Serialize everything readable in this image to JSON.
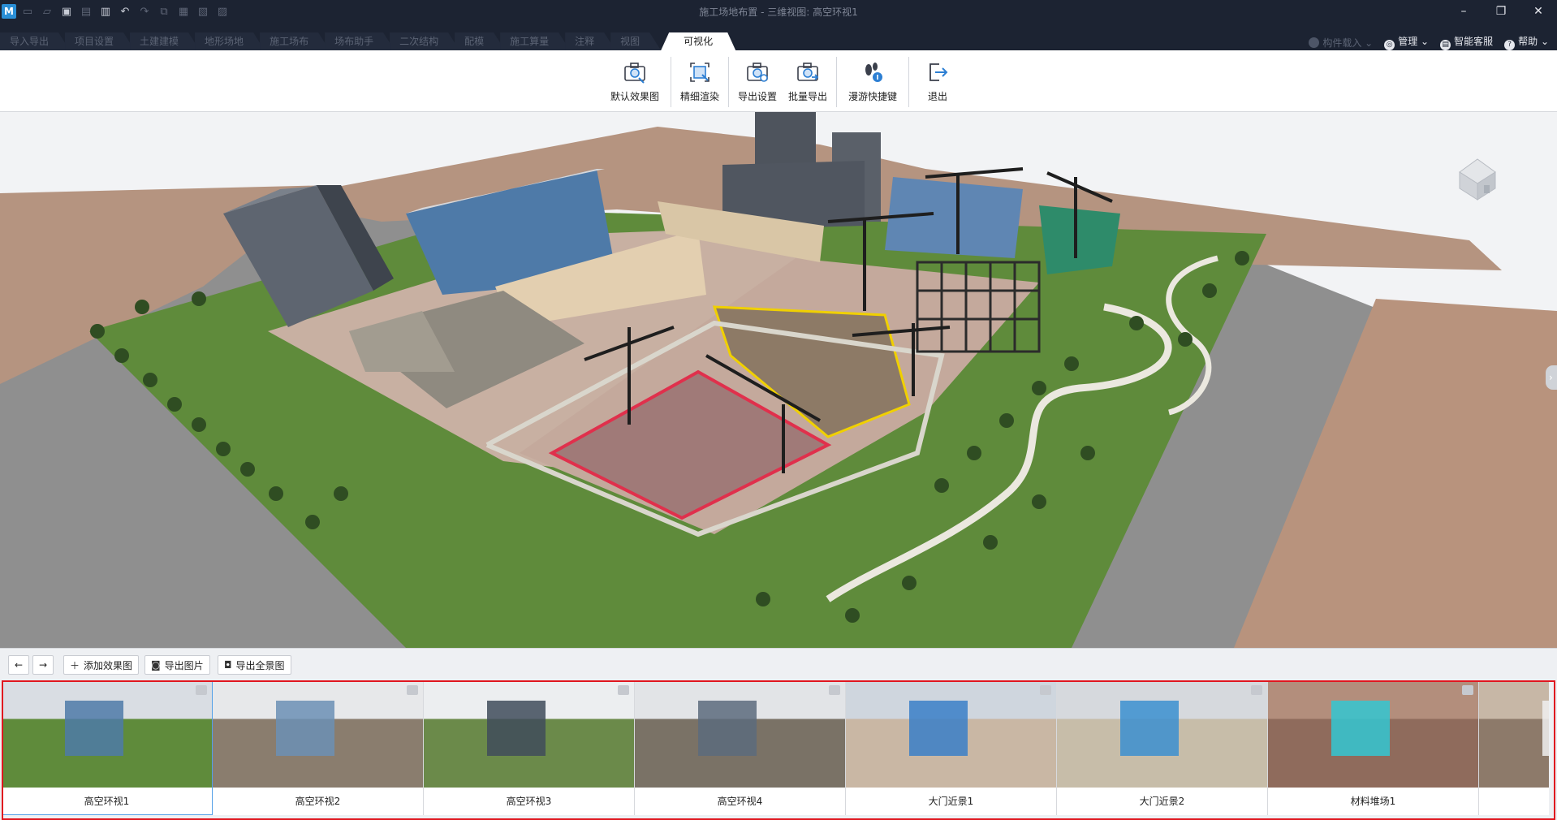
{
  "window": {
    "title": "施工场地布置 - 三维视图: 高空环视1",
    "logo": "M",
    "controls": {
      "minimize": "–",
      "restore": "❐",
      "close": "✕"
    }
  },
  "quick_access": [
    "file-icon",
    "open-icon",
    "save-icon",
    "save-as-icon",
    "export-icon",
    "undo-icon",
    "redo-icon",
    "copy-icon",
    "paste-icon",
    "window-icon",
    "layout-icon"
  ],
  "menu_tabs": [
    {
      "label": "导入导出"
    },
    {
      "label": "项目设置"
    },
    {
      "label": "土建建模"
    },
    {
      "label": "地形场地"
    },
    {
      "label": "施工场布"
    },
    {
      "label": "场布助手"
    },
    {
      "label": "二次结构"
    },
    {
      "label": "配模"
    },
    {
      "label": "施工算量"
    },
    {
      "label": "注释"
    },
    {
      "label": "视图"
    },
    {
      "label": "可视化",
      "active": true
    }
  ],
  "right_menu": {
    "component_load": "构件载入",
    "manage": "管理",
    "support": "智能客服",
    "help": "帮助"
  },
  "ribbon": {
    "default_render": "默认效果图",
    "fine_render": "精细渲染",
    "export_settings": "导出设置",
    "batch_export": "批量导出",
    "walk_shortcuts": "漫游快捷键",
    "exit": "退出"
  },
  "lower_toolbar": {
    "prev": "←",
    "next": "→",
    "add_render": "添加效果图",
    "export_image": "导出图片",
    "export_panorama": "导出全景图"
  },
  "thumbnails": [
    {
      "label": "高空环视1",
      "selected": true
    },
    {
      "label": "高空环视2"
    },
    {
      "label": "高空环视3"
    },
    {
      "label": "高空环视4"
    },
    {
      "label": "大门近景1"
    },
    {
      "label": "大门近景2"
    },
    {
      "label": "材料堆场1"
    },
    {
      "label": ""
    }
  ],
  "colors": {
    "titlebar": "#1c2332",
    "highlight_border": "#e0161f",
    "grass": "#5e8a3a",
    "road": "#8d8d8d",
    "soil": "#b4907c"
  }
}
